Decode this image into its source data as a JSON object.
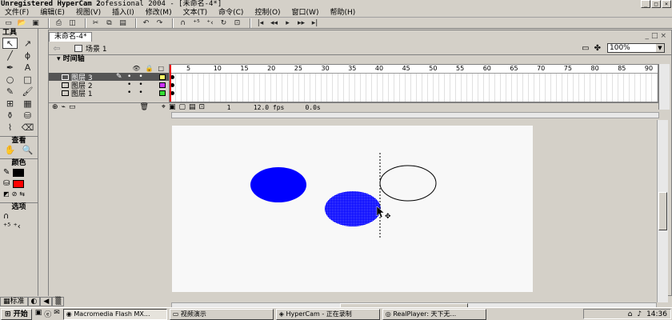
{
  "titlebar": {
    "title_main": "Unregistered HyperCam 2",
    "title_rest": "ofessional 2004 - [未命名-4*]"
  },
  "menu": [
    "文件(F)",
    "编辑(E)",
    "视图(V)",
    "插入(I)",
    "修改(M)",
    "文本(T)",
    "命令(C)",
    "控制(O)",
    "窗口(W)",
    "帮助(H)"
  ],
  "toolbar_icons": [
    "new-icon",
    "open-icon",
    "save-icon",
    "print-icon",
    "preview-icon",
    "cut-icon",
    "copy-icon",
    "paste-icon",
    "undo-icon",
    "redo-icon",
    "magnet-icon",
    "smooth-icon",
    "straighten-icon",
    "rotate-icon",
    "scale-icon",
    "step-back-icon",
    "rewind-icon",
    "play-icon",
    "forward-icon",
    "end-icon"
  ],
  "tools": {
    "header": "工具",
    "view_label": "查看",
    "colors_label": "颜色",
    "options_label": "选项",
    "stroke_color": "#000000",
    "fill_color": "#ff0000"
  },
  "document": {
    "tab": "未命名-4*",
    "scene": "场景 1",
    "zoom": "100%"
  },
  "timeline": {
    "header": "时间轴",
    "layers": [
      {
        "name": "图层 3",
        "selected": true,
        "color": "#ffff66"
      },
      {
        "name": "图层 2",
        "selected": false,
        "color": "#cc33ff"
      },
      {
        "name": "图层 1",
        "selected": false,
        "color": "#33dd33"
      }
    ],
    "ruler": [
      "5",
      "10",
      "15",
      "20",
      "25",
      "30",
      "35",
      "40",
      "45",
      "50",
      "55",
      "60",
      "65",
      "70",
      "75",
      "80",
      "85",
      "90"
    ],
    "current_frame": "1",
    "fps": "12.0 fps",
    "time": "0.0s"
  },
  "stage": {
    "shapes": [
      {
        "kind": "filled",
        "color": "#0000ff"
      },
      {
        "kind": "selected-filled",
        "color": "#0000ff"
      },
      {
        "kind": "outline",
        "color": "#000000"
      }
    ]
  },
  "left_tabs": [
    "标准"
  ],
  "taskbar": {
    "start": "开始",
    "tasks": [
      "Macromedia Flash MX...",
      "视频演示",
      "HyperCam - 正在录制",
      "RealPlayer: 天下无..."
    ],
    "clock": "14:36"
  }
}
